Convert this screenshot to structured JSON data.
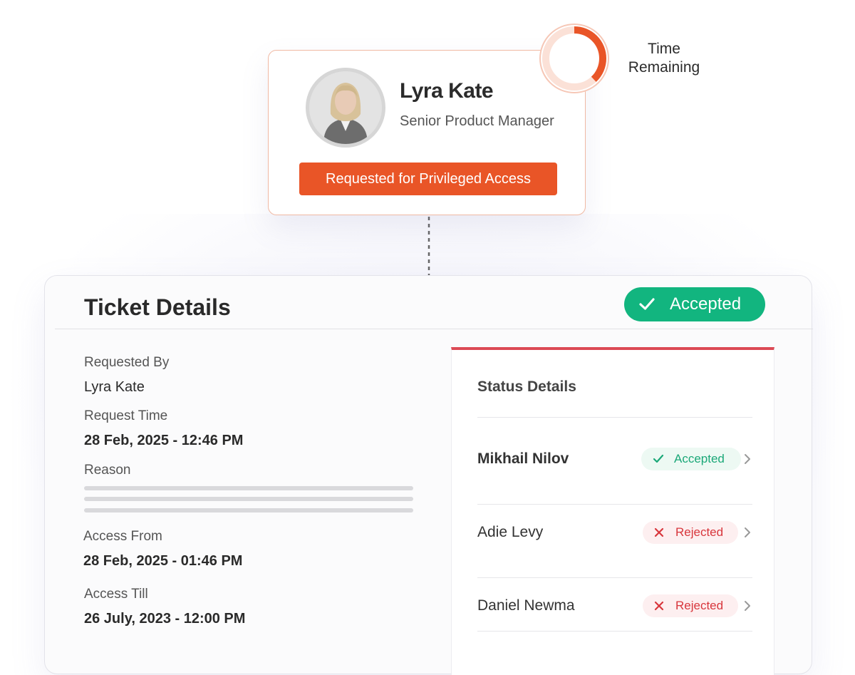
{
  "profile": {
    "name": "Lyra Kate",
    "role": "Senior Product Manager",
    "request_label": "Requested for Privileged Access",
    "avatar_icon": "user-photo"
  },
  "timer": {
    "label_line1": "Time",
    "label_line2": "Remaining",
    "remaining_fraction": 0.38,
    "color": "#e95527"
  },
  "ticket": {
    "title": "Ticket Details",
    "status": "Accepted",
    "status_color": "#12b57f",
    "fields": {
      "requested_by_label": "Requested By",
      "requested_by_value": "Lyra Kate",
      "request_time_label": "Request Time",
      "request_time_value": "28 Feb, 2025 - 12:46 PM",
      "reason_label": "Reason",
      "access_from_label": "Access From",
      "access_from_value": "28 Feb, 2025 - 01:46 PM",
      "access_till_label": "Access Till",
      "access_till_value": "26 July, 2023 - 12:00 PM"
    }
  },
  "status_details": {
    "title": "Status Details",
    "accent_color": "#dc4a55",
    "rows": [
      {
        "name": "Mikhail Nilov",
        "status": "Accepted",
        "icon": "check-icon"
      },
      {
        "name": "Adie Levy",
        "status": "Rejected",
        "icon": "x-icon"
      },
      {
        "name": "Daniel Newma",
        "status": "Rejected",
        "icon": "x-icon"
      }
    ]
  }
}
